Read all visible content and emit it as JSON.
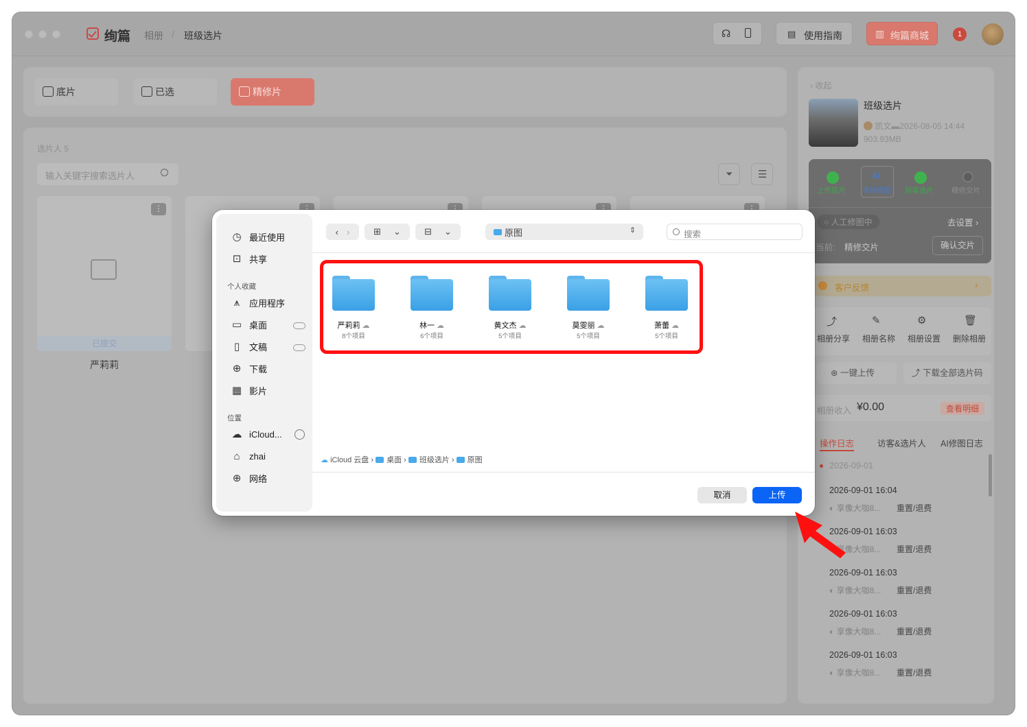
{
  "app": {
    "brand": "绚篇",
    "breadcrumb": [
      "相册",
      "班级选片"
    ],
    "guide_label": "使用指南",
    "store_label": "绚篇商城",
    "notif_badge": "1"
  },
  "tabs": [
    {
      "label": "底片",
      "active": false
    },
    {
      "label": "已选",
      "active": false
    },
    {
      "label": "精修片",
      "active": true
    }
  ],
  "selectors": {
    "count_label": "选片人 5",
    "search_placeholder": "输入关键字搜索选片人",
    "cards": [
      {
        "status": "已提交",
        "name": "严莉莉"
      }
    ]
  },
  "album": {
    "collapse_label": "收起",
    "title": "班级选片",
    "owner": "凯文",
    "date": "2026-08-05 14:44",
    "size": "903.93MB",
    "steps": [
      "上传底片",
      "手动修图",
      "顾客选片",
      "精修交片"
    ],
    "status": "人工修图中",
    "set_label": "去设置",
    "current_label": "当前:",
    "current_value": "精修交片",
    "confirm_label": "确认交片",
    "feedback_label": "客户反馈",
    "actions": [
      "相册分享",
      "相册名称",
      "相册设置",
      "删除相册"
    ],
    "upload_all": "一键上传",
    "download_codes": "下载全部选片码",
    "income_label": "相册收入",
    "income_value": "¥0.00",
    "detail_label": "查看明细",
    "log_tabs": [
      "操作日志",
      "访客&选片人",
      "AI修图日志"
    ],
    "log_date": "2026-09-01",
    "logs": [
      {
        "time": "2026-09-01 16:04",
        "user": "享像大咖8...",
        "action": "重置/退费"
      },
      {
        "time": "2026-09-01 16:03",
        "user": "享像大咖8...",
        "action": "重置/退费"
      },
      {
        "time": "2026-09-01 16:03",
        "user": "享像大咖8...",
        "action": "重置/退费"
      },
      {
        "time": "2026-09-01 16:03",
        "user": "享像大咖8...",
        "action": "重置/退费"
      },
      {
        "time": "2026-09-01 16:03",
        "user": "享像大咖8...",
        "action": "重置/退费"
      }
    ]
  },
  "dialog": {
    "sidebar": {
      "top": [
        "最近使用",
        "共享"
      ],
      "favorites_head": "个人收藏",
      "favorites": [
        "应用程序",
        "桌面",
        "文稿",
        "下载",
        "影片"
      ],
      "locations_head": "位置",
      "locations": [
        "iCloud...",
        "zhai",
        "网络"
      ]
    },
    "location": "原图",
    "search_placeholder": "搜索",
    "folders": [
      {
        "name": "严莉莉",
        "count": "8个项目"
      },
      {
        "name": "林一",
        "count": "6个项目"
      },
      {
        "name": "黄文杰",
        "count": "5个项目"
      },
      {
        "name": "莫雯丽",
        "count": "5个项目"
      },
      {
        "name": "萧蕾",
        "count": "5个项目"
      }
    ],
    "path": [
      "iCloud 云盘",
      "桌面",
      "班级选片",
      "原图"
    ],
    "cancel_label": "取消",
    "upload_label": "上传"
  },
  "colors": {
    "accent": "#0a64f5",
    "highlight": "#ff1010",
    "brand": "#d9796e"
  }
}
